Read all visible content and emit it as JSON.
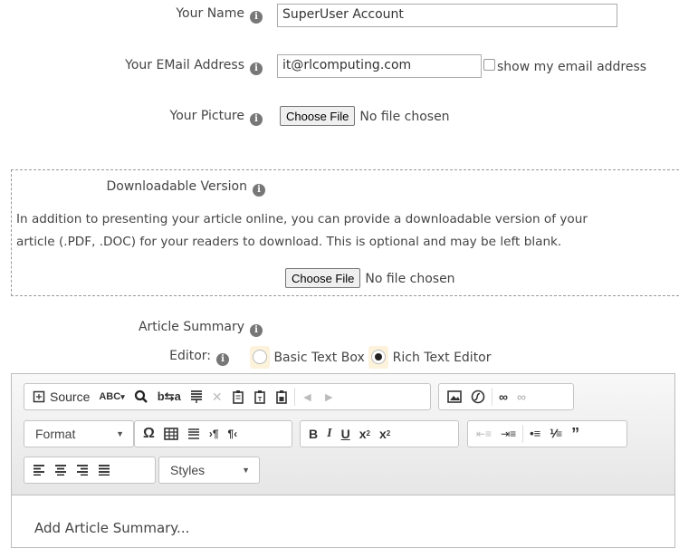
{
  "name_field": {
    "label": "Your Name",
    "value": "SuperUser Account"
  },
  "email_field": {
    "label": "Your EMail Address",
    "value": "it@rlcomputing.com",
    "show_email_label": "show my email address"
  },
  "picture_field": {
    "label": "Your Picture",
    "button": "Choose File",
    "status": "No file chosen"
  },
  "download_section": {
    "label": "Downloadable Version",
    "description_line1": "In addition to presenting your article online, you can provide a downloadable version of your",
    "description_line2": "article (.PDF, .DOC) for your readers to download. This is optional and may be left blank.",
    "button": "Choose File",
    "status": "No file chosen"
  },
  "summary": {
    "label": "Article Summary"
  },
  "editor_choice": {
    "label": "Editor:",
    "basic": "Basic Text Box",
    "rich": "Rich Text Editor",
    "selected": "Rich Text Editor"
  },
  "toolbar": {
    "source": "Source",
    "format": "Format",
    "styles": "Styles",
    "icons": [
      "document-icon",
      "spellcheck-icon",
      "find-icon",
      "replace-icon",
      "select-all-icon",
      "cut-icon",
      "copy-icon",
      "paste-icon",
      "paste-text-icon",
      "paste-word-icon",
      "undo-icon",
      "redo-icon",
      "image-icon",
      "flash-icon",
      "link-icon",
      "unlink-icon",
      "special-char-icon",
      "table-icon",
      "horizontal-rule-icon",
      "ltr-icon",
      "rtl-icon",
      "bold-icon",
      "italic-icon",
      "underline-icon",
      "subscript-icon",
      "superscript-icon",
      "outdent-icon",
      "indent-icon",
      "bullet-list-icon",
      "number-list-icon",
      "blockquote-icon",
      "align-left-icon",
      "align-center-icon",
      "align-right-icon",
      "justify-icon"
    ]
  },
  "editor_content": {
    "placeholder": "Add Article Summary..."
  }
}
